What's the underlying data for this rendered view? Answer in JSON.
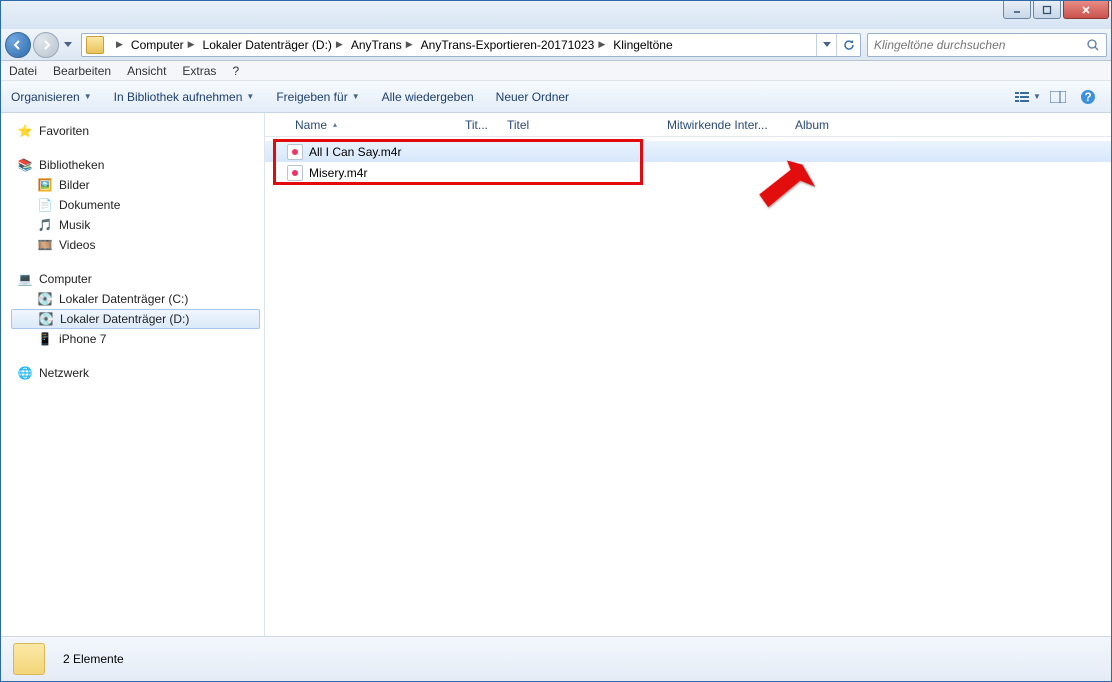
{
  "breadcrumb": [
    "Computer",
    "Lokaler Datenträger (D:)",
    "AnyTrans",
    "AnyTrans-Exportieren-20171023",
    "Klingeltöne"
  ],
  "search": {
    "placeholder": "Klingeltöne durchsuchen"
  },
  "menu": {
    "datei": "Datei",
    "bearbeiten": "Bearbeiten",
    "ansicht": "Ansicht",
    "extras": "Extras",
    "hilfe": "?"
  },
  "toolbar": {
    "organisieren": "Organisieren",
    "bibliothek": "In Bibliothek aufnehmen",
    "freigeben": "Freigeben für",
    "wiedergeben": "Alle wiedergeben",
    "neu": "Neuer Ordner"
  },
  "tree": {
    "favoriten": "Favoriten",
    "bibliotheken": "Bibliotheken",
    "bib_items": [
      "Bilder",
      "Dokumente",
      "Musik",
      "Videos"
    ],
    "computer": "Computer",
    "comp_items": [
      "Lokaler Datenträger (C:)",
      "Lokaler Datenträger (D:)",
      "iPhone 7"
    ],
    "netzwerk": "Netzwerk"
  },
  "columns": {
    "name": "Name",
    "tit": "Tit...",
    "titel": "Titel",
    "mitwirkende": "Mitwirkende Inter...",
    "album": "Album"
  },
  "files": [
    "All I Can Say.m4r",
    "Misery.m4r"
  ],
  "status": {
    "text": "2 Elemente"
  }
}
